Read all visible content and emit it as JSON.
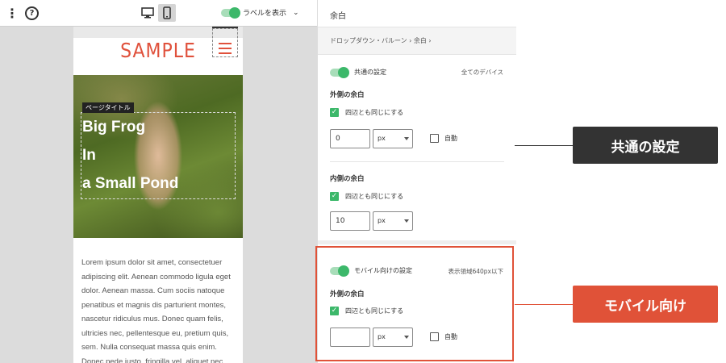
{
  "toolbar": {
    "kebab": "⋮",
    "help": "?",
    "show_labels": "ラベルを表示",
    "chevron": "⌄"
  },
  "preview": {
    "logo": "SAMPLE",
    "hero_tag": "ページタイトル",
    "hero_lines": [
      "Big Frog",
      "In",
      "a Small Pond"
    ],
    "body": "Lorem ipsum dolor sit amet, consectetuer adipiscing elit. Aenean commodo ligula eget dolor. Aenean massa. Cum sociis natoque penatibus et magnis dis parturient montes, nascetur ridiculus mus. Donec quam felis, ultricies nec, pellentesque eu, pretium quis, sem. Nulla consequat massa quis enim. Donec pede justo, fringilla vel, aliquet nec,"
  },
  "panel": {
    "title": "余白",
    "breadcrumb": "ドロップダウン・バルーン › 余白 ›",
    "common": {
      "toggle_label": "共通の設定",
      "scope": "全てのデバイス",
      "outer_title": "外側の余白",
      "outer_check": "四辺とも同じにする",
      "outer_value": "0",
      "outer_unit": "px",
      "auto": "自動",
      "inner_title": "内側の余白",
      "inner_check": "四辺とも同じにする",
      "inner_value": "10",
      "inner_unit": "px"
    },
    "mobile": {
      "toggle_label": "モバイル向けの設定",
      "scope": "表示領域640px以下",
      "outer_title": "外側の余白",
      "outer_check": "四辺とも同じにする",
      "outer_value": "",
      "outer_unit": "px",
      "auto": "自動"
    }
  },
  "callouts": {
    "common": "共通の設定",
    "mobile": "モバイル向け"
  },
  "colors": {
    "accent_green": "#3cb86a",
    "brand_red": "#e0513c",
    "callout_dark": "#333333",
    "callout_red": "#e05238"
  }
}
